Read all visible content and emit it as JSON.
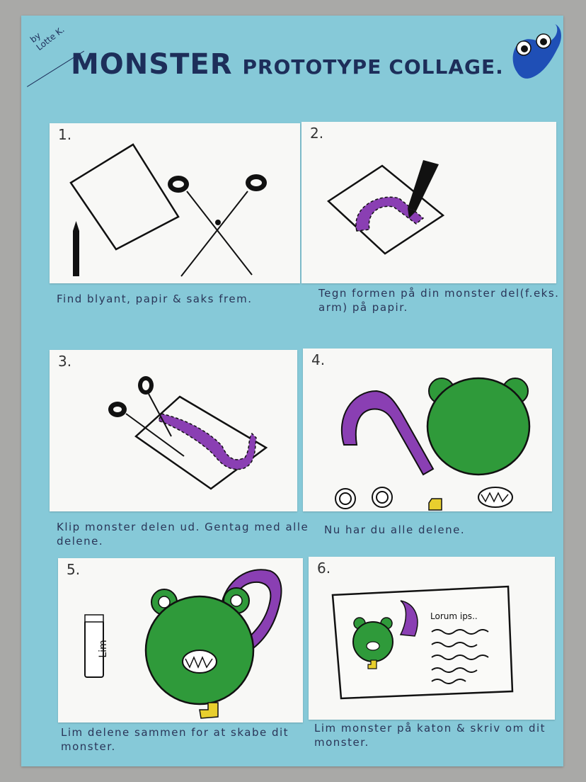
{
  "poster": {
    "byline_line1": "by",
    "byline_line2": "Lotte K.",
    "title_word1": "MONSTER",
    "title_word2": "PROTOTYPE",
    "title_word3": "COLLAGE."
  },
  "steps": [
    {
      "number": "1.",
      "caption": "Find blyant, papir & saks frem."
    },
    {
      "number": "2.",
      "caption": "Tegn formen på din monster del(f.eks. arm) på papir."
    },
    {
      "number": "3.",
      "caption": "Klip monster delen ud. Gentag med alle delene."
    },
    {
      "number": "4.",
      "caption": "Nu har du alle delene."
    },
    {
      "number": "5.",
      "caption": "Lim delene sammen for at skabe dit monster."
    },
    {
      "number": "6.",
      "caption": "Lim monster på katon & skriv om dit monster."
    }
  ],
  "drawings": {
    "glue_label": "Lim",
    "card_text": "Lorum ips.."
  },
  "colors": {
    "board": "#86c9d8",
    "purple": "#8a3fb3",
    "green": "#2f9a3a",
    "yellow": "#e8cf2e",
    "ink": "#111111"
  }
}
